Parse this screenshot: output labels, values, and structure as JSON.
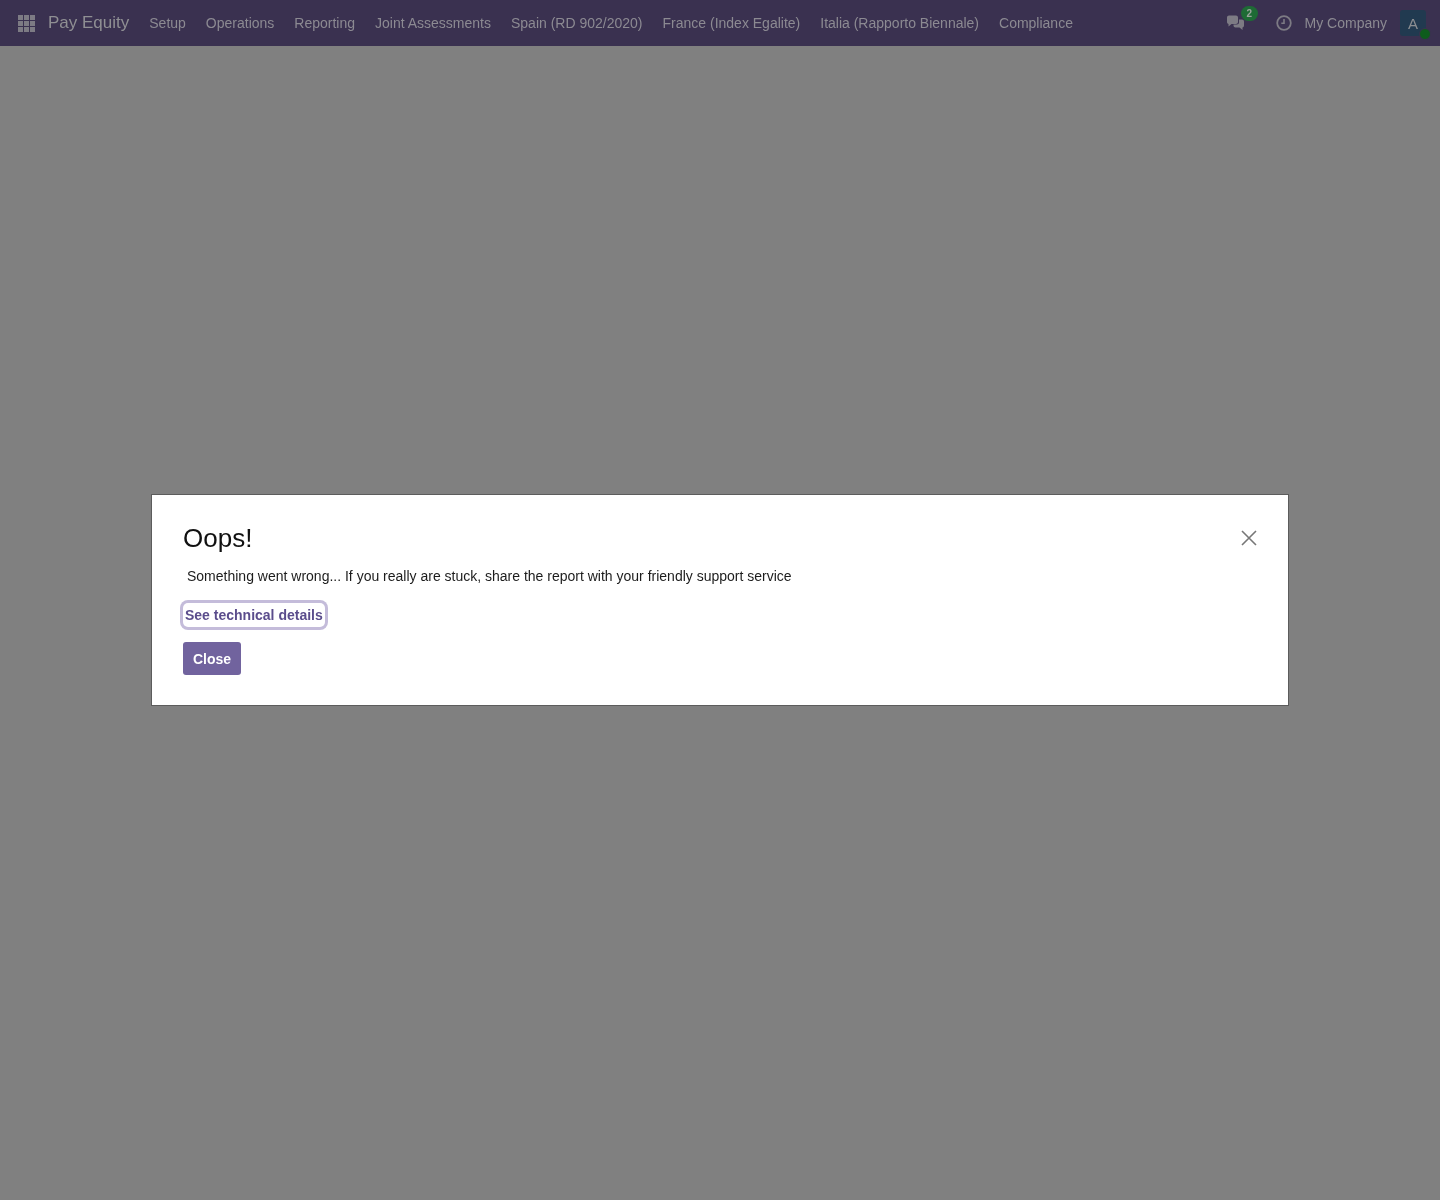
{
  "navbar": {
    "app_name": "Pay Equity",
    "menu": [
      "Setup",
      "Operations",
      "Reporting",
      "Joint Assessments",
      "Spain (RD 902/2020)",
      "France (Index Egalite)",
      "Italia (Rapporto Biennale)",
      "Compliance"
    ],
    "messages_badge": "2",
    "company": "My Company",
    "avatar_initial": "A",
    "online": true
  },
  "dialog": {
    "title": "Oops!",
    "message": "Something went wrong... If you really are stuck, share the report with your friendly support service",
    "details_link": {
      "label": "See technical details",
      "focused": true
    },
    "close_button": "Close"
  }
}
